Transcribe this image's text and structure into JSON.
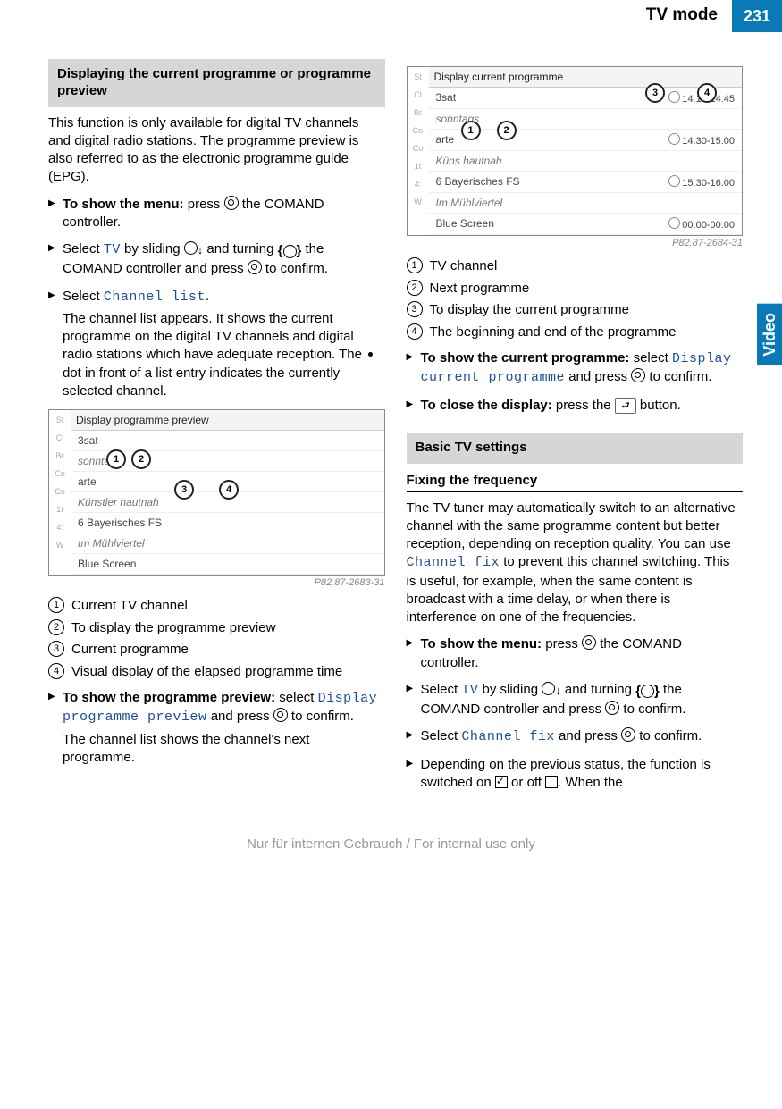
{
  "header": {
    "title": "TV mode",
    "page": "231"
  },
  "side_tab": "Video",
  "col1": {
    "section1_title": "Displaying the current programme or programme preview",
    "intro": "This function is only available for digital TV channels and digital radio stations. The programme preview is also referred to as the electronic programme guide (EPG).",
    "steps1": {
      "a_lead": "To show the menu:",
      "a_rest": " press ",
      "a_tail": " the COMAND controller.",
      "b_pre": "Select ",
      "b_tv": "TV",
      "b_mid": " by sliding ",
      "b_mid2": " and turning ",
      "b_tail": " the COMAND controller and press ",
      "b_end": " to confirm.",
      "c_pre": "Select ",
      "c_link": "Channel list",
      "c_post": ".",
      "c_desc": "The channel list appears. It shows the current programme on the digital TV channels and digital radio stations which have adequate reception. The ",
      "c_desc2": " dot in front of a list entry indicates the currently selected channel."
    },
    "fig1": {
      "title": "Display programme preview",
      "rows": [
        {
          "left": "3sat",
          "right": ""
        },
        {
          "left": "sonntags",
          "right": ""
        },
        {
          "left": "arte",
          "right": ""
        },
        {
          "left": "Künstler hautnah",
          "right": ""
        },
        {
          "left": "6   Bayerisches FS",
          "right": ""
        },
        {
          "left": "Im Mühlviertel",
          "right": ""
        },
        {
          "left": "Blue Screen",
          "right": ""
        }
      ],
      "side": [
        "St",
        "Cl",
        "Br",
        "Co",
        "Co",
        "1t",
        "4:",
        "W"
      ],
      "caption": "P82.87-2683-31"
    },
    "legend1": [
      "Current TV channel",
      "To display the programme preview",
      "Current programme",
      "Visual display of the elapsed programme time"
    ],
    "steps2": {
      "a_lead": "To show the programme preview:",
      "a_mid": " select ",
      "a_link": "Display programme preview",
      "a_mid2": " and press ",
      "a_end": " to confirm.",
      "a_desc": "The channel list shows the channel's next programme."
    }
  },
  "col2": {
    "fig2": {
      "title": "Display current programme",
      "rows": [
        {
          "left": "3sat",
          "right": "14:15-14:45"
        },
        {
          "left": "sonntags",
          "right": ""
        },
        {
          "left": "arte",
          "right": "14:30-15:00"
        },
        {
          "left": "Küns   hautnah",
          "right": ""
        },
        {
          "left": "6   Bayerisches FS",
          "right": "15:30-16:00"
        },
        {
          "left": "Im Mühlviertel",
          "right": ""
        },
        {
          "left": "Blue Screen",
          "right": "00:00-00:00"
        }
      ],
      "side": [
        "St",
        "Cl",
        "Br",
        "Co",
        "Co",
        "1t",
        "4:",
        "W"
      ],
      "caption": "P82.87-2684-31"
    },
    "legend2": [
      "TV channel",
      "Next programme",
      "To display the current programme",
      "The beginning and end of the programme"
    ],
    "steps3": {
      "a_lead": "To show the current programme:",
      "a_mid": " select ",
      "a_link": "Display current programme",
      "a_mid2": " and press ",
      "a_end": " to confirm.",
      "b_lead": "To close the display:",
      "b_mid": " press the ",
      "b_end": " button."
    },
    "section2_title": "Basic TV settings",
    "sub": "Fixing the frequency",
    "freq_intro_pre": "The TV tuner may automatically switch to an alternative channel with the same programme content but better reception, depending on reception quality. You can use ",
    "freq_link": "Channel fix",
    "freq_intro_post": " to prevent this channel switching. This is useful, for example, when the same content is broadcast with a time delay, or when there is interference on one of the frequencies.",
    "steps4": {
      "a_lead": "To show the menu:",
      "a_mid": " press ",
      "a_end": " the COMAND controller.",
      "b_pre": "Select ",
      "b_tv": "TV",
      "b_mid": " by sliding ",
      "b_mid2": " and turning ",
      "b_tail": " the COMAND controller and press ",
      "b_end": " to confirm.",
      "c_pre": "Select ",
      "c_link": "Channel fix",
      "c_mid": " and press ",
      "c_end": " to confirm.",
      "d": "Depending on the previous status, the function is switched on ",
      "d_mid": " or off ",
      "d_end": ". When the"
    }
  },
  "footer": "Nur für internen Gebrauch / For internal use only"
}
